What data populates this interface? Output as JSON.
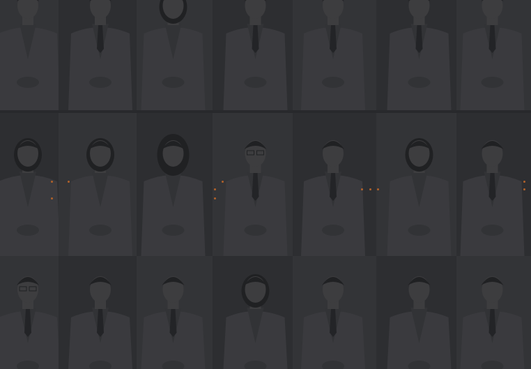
{
  "colors": {
    "background": "#2a2b2e",
    "tile_light": "#3b3c3f",
    "tile_dark": "#323336",
    "coat": "#45464a",
    "coat_shadow": "#3a3b3e",
    "skin": "#4a4a4c",
    "hair": "#1e1f21",
    "tie": "#232427",
    "accent_dots": "#b0612a"
  },
  "rows": [
    {
      "tiles": [
        {
          "hair": "short",
          "tie": false
        },
        {
          "hair": "short",
          "tie": true
        },
        {
          "hair": "bob",
          "tie": false
        },
        {
          "hair": "short",
          "tie": true
        },
        {
          "hair": "short",
          "tie": true
        },
        {
          "hair": "short",
          "tie": true
        },
        {
          "hair": "short",
          "tie": true
        }
      ]
    },
    {
      "tiles": [
        {
          "hair": "bob",
          "tie": false
        },
        {
          "hair": "bob",
          "tie": false
        },
        {
          "hair": "long",
          "tie": false
        },
        {
          "hair": "short",
          "tie": true,
          "glasses": true
        },
        {
          "hair": "short",
          "tie": true
        },
        {
          "hair": "bob",
          "tie": false
        },
        {
          "hair": "short",
          "tie": true
        }
      ]
    },
    {
      "tiles": [
        {
          "hair": "short",
          "tie": true,
          "glasses": true
        },
        {
          "hair": "short",
          "tie": true
        },
        {
          "hair": "short",
          "tie": true
        },
        {
          "hair": "bob",
          "tie": false
        },
        {
          "hair": "short",
          "tie": true
        },
        {
          "hair": "short",
          "tie": false
        },
        {
          "hair": "short",
          "tie": true
        }
      ]
    }
  ]
}
